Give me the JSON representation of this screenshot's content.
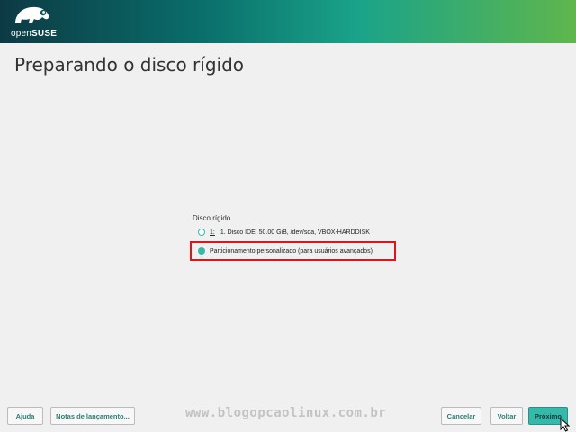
{
  "header": {
    "logo_prefix": "open",
    "logo_brand": "SUSE",
    "gradient_colors": [
      "#0c3a44",
      "#1aa38a",
      "#5fb64c"
    ]
  },
  "page": {
    "title": "Preparando o disco rígido"
  },
  "disk_selection": {
    "group_label": "Disco rígido",
    "options": [
      {
        "number": "1:",
        "label": "1. Disco IDE, 50.00 GiB, /dev/sda, VBOX-HARDDISK",
        "selected": false
      },
      {
        "label": "Particionamento personalizado (para usuários avançados)",
        "selected": true
      }
    ]
  },
  "accent_color": "#35b9ab",
  "highlight_color": "#e0151b",
  "buttons": {
    "help": "Ajuda",
    "release_notes": "Notas de lançamento...",
    "cancel": "Cancelar",
    "back": "Voltar",
    "next": "Próximo"
  },
  "watermark": "www.blogopcaolinux.com.br",
  "icons": {
    "logo": "chameleon-icon",
    "cursor": "mouse-pointer-icon"
  }
}
